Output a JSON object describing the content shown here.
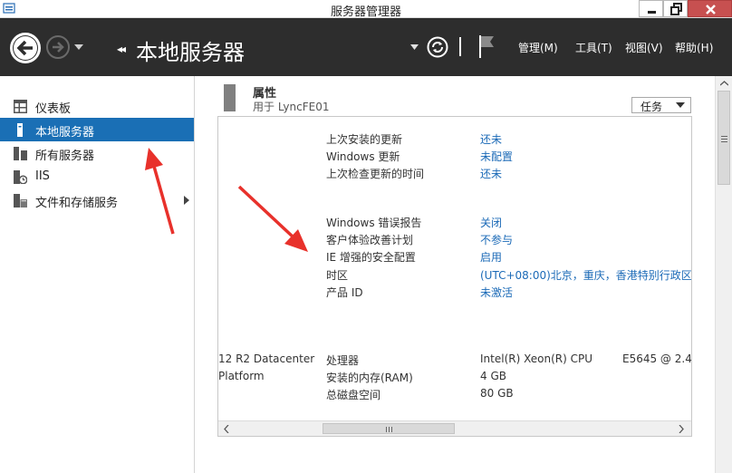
{
  "window": {
    "title": "服务器管理器"
  },
  "header": {
    "crumb_arrows": "◂◂",
    "page_title": "本地服务器",
    "menus": [
      "管理(M)",
      "工具(T)",
      "视图(V)",
      "帮助(H)"
    ]
  },
  "sidebar": {
    "items": [
      {
        "label": "仪表板",
        "icon": "dashboard-icon"
      },
      {
        "label": "本地服务器",
        "icon": "server-icon",
        "active": true
      },
      {
        "label": "所有服务器",
        "icon": "servers-icon"
      },
      {
        "label": "IIS",
        "icon": "iis-icon"
      },
      {
        "label": "文件和存储服务",
        "icon": "file-storage-icon",
        "expandable": true
      }
    ]
  },
  "main": {
    "section_title": "属性",
    "section_subtitle": "用于 LyncFE01",
    "tasks_label": "任务",
    "properties": [
      {
        "label": "上次安装的更新",
        "value": "还未"
      },
      {
        "label": "Windows 更新",
        "value": "未配置"
      },
      {
        "label": "上次检查更新的时间",
        "value": "还未"
      },
      {
        "label": "Windows 错误报告",
        "value": "关闭"
      },
      {
        "label": "客户体验改善计划",
        "value": "不参与"
      },
      {
        "label": "IE 增强的安全配置",
        "value": "启用"
      },
      {
        "label": "时区",
        "value": "(UTC+08:00)北京，重庆，香港特别行政区"
      },
      {
        "label": "产品 ID",
        "value": "未激活"
      },
      {
        "label": "处理器",
        "value": "Intel(R) Xeon(R) CPU",
        "extra": "E5645  @ 2.4"
      },
      {
        "label": "安装的内存(RAM)",
        "value": "4 GB"
      },
      {
        "label": "总磁盘空间",
        "value": "80 GB"
      }
    ],
    "os_edition_line1": "12 R2 Datacenter",
    "os_edition_line2": "Platform"
  },
  "colors": {
    "header_bg": "#2d2d2d",
    "sidebar_active": "#1a6fb5",
    "link": "#1b6ab7",
    "annotation_red": "#e8312b"
  }
}
